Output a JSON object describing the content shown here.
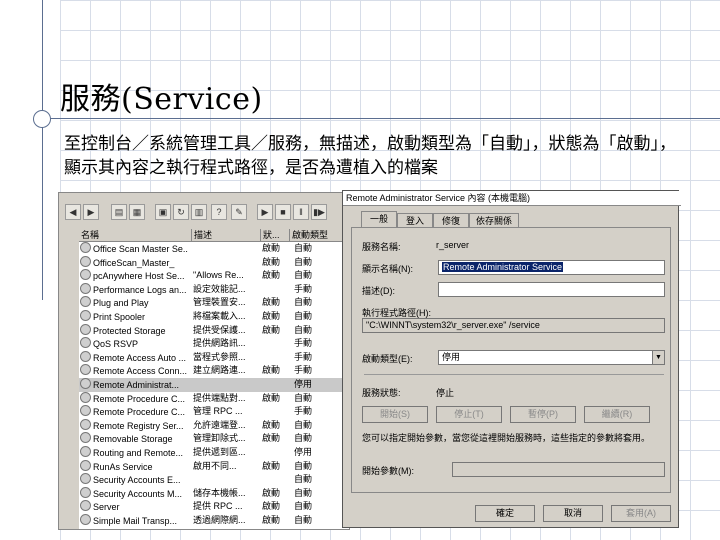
{
  "slide": {
    "title": "服務(Service)",
    "description": "至控制台／系統管理工具／服務，無描述，啟動類型為「自動」，狀態為「啟動」，顯示其內容之執行程式路徑，是否為遭植入的檔案"
  },
  "services_window": {
    "columns": [
      "名稱",
      "描述",
      "狀...",
      "啟動類型"
    ],
    "rows": [
      {
        "name": "Office Scan Master Se...",
        "desc": "",
        "status": "啟動",
        "startup": "自動"
      },
      {
        "name": "OfficeScan_Master_",
        "desc": "",
        "status": "啟動",
        "startup": "自動"
      },
      {
        "name": "pcAnywhere Host Se...",
        "desc": "\"Allows Re...",
        "status": "啟動",
        "startup": "自動"
      },
      {
        "name": "Performance Logs an...",
        "desc": "設定效能記...",
        "status": "",
        "startup": "手動"
      },
      {
        "name": "Plug and Play",
        "desc": "管理裝置安...",
        "status": "啟動",
        "startup": "自動"
      },
      {
        "name": "Print Spooler",
        "desc": "將檔案載入...",
        "status": "啟動",
        "startup": "自動"
      },
      {
        "name": "Protected Storage",
        "desc": "提供受保護...",
        "status": "啟動",
        "startup": "自動"
      },
      {
        "name": "QoS RSVP",
        "desc": "提供網路訊...",
        "status": "",
        "startup": "手動"
      },
      {
        "name": "Remote Access Auto ...",
        "desc": "當程式參照...",
        "status": "",
        "startup": "手動"
      },
      {
        "name": "Remote Access Conn...",
        "desc": "建立網路連...",
        "status": "啟動",
        "startup": "手動"
      },
      {
        "name": "Remote Administrat...",
        "desc": "",
        "status": "",
        "startup": "停用"
      },
      {
        "name": "Remote Procedure C...",
        "desc": "提供端點對...",
        "status": "啟動",
        "startup": "自動"
      },
      {
        "name": "Remote Procedure C...",
        "desc": "管理 RPC ...",
        "status": "",
        "startup": "手動"
      },
      {
        "name": "Remote Registry Ser...",
        "desc": "允許遠端登...",
        "status": "啟動",
        "startup": "自動"
      },
      {
        "name": "Removable Storage",
        "desc": "管理卸除式...",
        "status": "啟動",
        "startup": "自動"
      },
      {
        "name": "Routing and Remote...",
        "desc": "提供遞到區...",
        "status": "",
        "startup": "停用"
      },
      {
        "name": "RunAs Service",
        "desc": "啟用不同...",
        "status": "啟動",
        "startup": "自動"
      },
      {
        "name": "Security Accounts E...",
        "desc": "",
        "status": "",
        "startup": "自動"
      },
      {
        "name": "Security Accounts M...",
        "desc": "儲存本機帳...",
        "status": "啟動",
        "startup": "自動"
      },
      {
        "name": "Server",
        "desc": "提供 RPC ...",
        "status": "啟動",
        "startup": "自動"
      },
      {
        "name": "Simple Mail Transp...",
        "desc": "透過網際網...",
        "status": "啟動",
        "startup": "自動"
      }
    ],
    "selected_index": 10
  },
  "dialog": {
    "title": "Remote Administrator Service 內容 (本機電腦)",
    "tabs": [
      "一般",
      "登入",
      "修復",
      "依存關係"
    ],
    "service_name_label": "服務名稱:",
    "service_name": "r_server",
    "display_name_label": "顯示名稱(N):",
    "display_name": "Remote Administrator Service",
    "description_label": "描述(D):",
    "description": "",
    "exe_path_label": "執行程式路徑(H):",
    "exe_path": "\"C:\\WINNT\\system32\\r_server.exe\" /service",
    "startup_type_label": "啟動類型(E):",
    "startup_type": "停用",
    "status_label": "服務狀態:",
    "status": "停止",
    "buttons": {
      "start": "開始(S)",
      "stop": "停止(T)",
      "pause": "暫停(P)",
      "resume": "繼續(R)"
    },
    "hint": "您可以指定開始參數，當您從這裡開始服務時，這些指定的參數將套用。",
    "start_params_label": "開始參數(M):",
    "ok": "確定",
    "cancel": "取消",
    "apply": "套用(A)"
  }
}
